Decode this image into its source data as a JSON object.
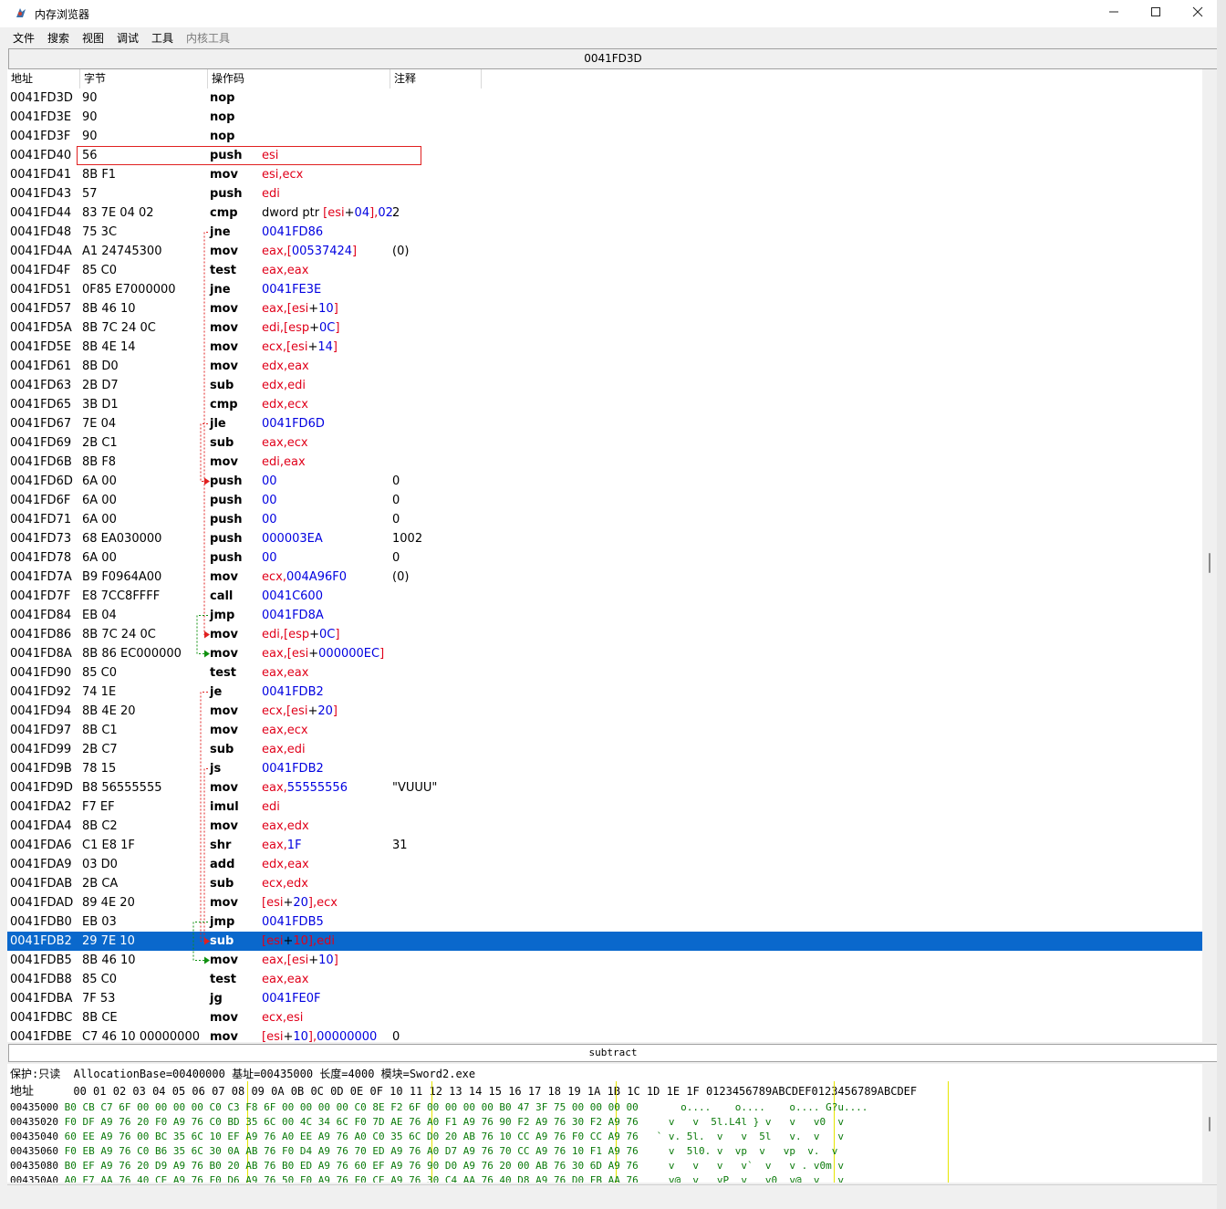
{
  "window": {
    "title": "内存浏览器",
    "address_bar": "0041FD3D",
    "minimize_icon": "minimize-icon",
    "maximize_icon": "maximize-icon",
    "close_icon": "close-icon"
  },
  "menu": [
    "文件",
    "搜索",
    "视图",
    "调试",
    "工具",
    "内核工具"
  ],
  "columns": {
    "addr": "地址",
    "bytes": "字节",
    "opcode": "操作码",
    "comment": "注释"
  },
  "disasm_rows": [
    {
      "addr": "0041FD3D",
      "bytes": "90",
      "op": "nop",
      "ops": [],
      "comment": ""
    },
    {
      "addr": "0041FD3E",
      "bytes": "90",
      "op": "nop",
      "ops": [],
      "comment": ""
    },
    {
      "addr": "0041FD3F",
      "bytes": "90",
      "op": "nop",
      "ops": [],
      "comment": ""
    },
    {
      "addr": "0041FD40",
      "bytes": "56",
      "op": "push",
      "ops": [
        [
          "t",
          "esi"
        ]
      ],
      "comment": ""
    },
    {
      "addr": "0041FD41",
      "bytes": "8B F1",
      "op": "mov",
      "ops": [
        [
          "t",
          "esi,ecx"
        ]
      ],
      "comment": ""
    },
    {
      "addr": "0041FD43",
      "bytes": "57",
      "op": "push",
      "ops": [
        [
          "t",
          "edi"
        ]
      ],
      "comment": ""
    },
    {
      "addr": "0041FD44",
      "bytes": "83 7E 04 02",
      "op": "cmp",
      "ops": [
        [
          "k",
          "dword ptr "
        ],
        [
          "t",
          "["
        ],
        [
          "t",
          "esi"
        ],
        [
          "k",
          "+"
        ],
        [
          "n",
          "04"
        ],
        [
          "t",
          "],"
        ],
        [
          "n",
          "02"
        ]
      ],
      "comment": "2"
    },
    {
      "addr": "0041FD48",
      "bytes": "75 3C",
      "op": "jne",
      "ops": [
        [
          "n",
          "0041FD86"
        ]
      ],
      "comment": ""
    },
    {
      "addr": "0041FD4A",
      "bytes": "A1 24745300",
      "op": "mov",
      "ops": [
        [
          "t",
          "eax,["
        ],
        [
          "n",
          "00537424"
        ],
        [
          "t",
          "]"
        ]
      ],
      "comment": "(0)"
    },
    {
      "addr": "0041FD4F",
      "bytes": "85 C0",
      "op": "test",
      "ops": [
        [
          "t",
          "eax,eax"
        ]
      ],
      "comment": ""
    },
    {
      "addr": "0041FD51",
      "bytes": "0F85 E7000000",
      "op": "jne",
      "ops": [
        [
          "n",
          "0041FE3E"
        ]
      ],
      "comment": ""
    },
    {
      "addr": "0041FD57",
      "bytes": "8B 46 10",
      "op": "mov",
      "ops": [
        [
          "t",
          "eax,[esi"
        ],
        [
          "k",
          "+"
        ],
        [
          "n",
          "10"
        ],
        [
          "t",
          "]"
        ]
      ],
      "comment": ""
    },
    {
      "addr": "0041FD5A",
      "bytes": "8B 7C 24 0C",
      "op": "mov",
      "ops": [
        [
          "t",
          "edi,[esp"
        ],
        [
          "k",
          "+"
        ],
        [
          "n",
          "0C"
        ],
        [
          "t",
          "]"
        ]
      ],
      "comment": ""
    },
    {
      "addr": "0041FD5E",
      "bytes": "8B 4E 14",
      "op": "mov",
      "ops": [
        [
          "t",
          "ecx,[esi"
        ],
        [
          "k",
          "+"
        ],
        [
          "n",
          "14"
        ],
        [
          "t",
          "]"
        ]
      ],
      "comment": ""
    },
    {
      "addr": "0041FD61",
      "bytes": "8B D0",
      "op": "mov",
      "ops": [
        [
          "t",
          "edx,eax"
        ]
      ],
      "comment": ""
    },
    {
      "addr": "0041FD63",
      "bytes": "2B D7",
      "op": "sub",
      "ops": [
        [
          "t",
          "edx,edi"
        ]
      ],
      "comment": ""
    },
    {
      "addr": "0041FD65",
      "bytes": "3B D1",
      "op": "cmp",
      "ops": [
        [
          "t",
          "edx,ecx"
        ]
      ],
      "comment": ""
    },
    {
      "addr": "0041FD67",
      "bytes": "7E 04",
      "op": "jle",
      "ops": [
        [
          "n",
          "0041FD6D"
        ]
      ],
      "comment": ""
    },
    {
      "addr": "0041FD69",
      "bytes": "2B C1",
      "op": "sub",
      "ops": [
        [
          "t",
          "eax,ecx"
        ]
      ],
      "comment": ""
    },
    {
      "addr": "0041FD6B",
      "bytes": "8B F8",
      "op": "mov",
      "ops": [
        [
          "t",
          "edi,eax"
        ]
      ],
      "comment": ""
    },
    {
      "addr": "0041FD6D",
      "bytes": "6A 00",
      "op": "push",
      "ops": [
        [
          "n",
          "00"
        ]
      ],
      "comment": "0"
    },
    {
      "addr": "0041FD6F",
      "bytes": "6A 00",
      "op": "push",
      "ops": [
        [
          "n",
          "00"
        ]
      ],
      "comment": "0"
    },
    {
      "addr": "0041FD71",
      "bytes": "6A 00",
      "op": "push",
      "ops": [
        [
          "n",
          "00"
        ]
      ],
      "comment": "0"
    },
    {
      "addr": "0041FD73",
      "bytes": "68 EA030000",
      "op": "push",
      "ops": [
        [
          "n",
          "000003EA"
        ]
      ],
      "comment": "1002"
    },
    {
      "addr": "0041FD78",
      "bytes": "6A 00",
      "op": "push",
      "ops": [
        [
          "n",
          "00"
        ]
      ],
      "comment": "0"
    },
    {
      "addr": "0041FD7A",
      "bytes": "B9 F0964A00",
      "op": "mov",
      "ops": [
        [
          "t",
          "ecx,"
        ],
        [
          "n",
          "004A96F0"
        ]
      ],
      "comment": "(0)"
    },
    {
      "addr": "0041FD7F",
      "bytes": "E8 7CC8FFFF",
      "op": "call",
      "ops": [
        [
          "n",
          "0041C600"
        ]
      ],
      "comment": ""
    },
    {
      "addr": "0041FD84",
      "bytes": "EB 04",
      "op": "jmp",
      "ops": [
        [
          "n",
          "0041FD8A"
        ]
      ],
      "comment": ""
    },
    {
      "addr": "0041FD86",
      "bytes": "8B 7C 24 0C",
      "op": "mov",
      "ops": [
        [
          "t",
          "edi,[esp"
        ],
        [
          "k",
          "+"
        ],
        [
          "n",
          "0C"
        ],
        [
          "t",
          "]"
        ]
      ],
      "comment": ""
    },
    {
      "addr": "0041FD8A",
      "bytes": "8B 86 EC000000",
      "op": "mov",
      "ops": [
        [
          "t",
          "eax,[esi"
        ],
        [
          "k",
          "+"
        ],
        [
          "n",
          "000000EC"
        ],
        [
          "t",
          "]"
        ]
      ],
      "comment": ""
    },
    {
      "addr": "0041FD90",
      "bytes": "85 C0",
      "op": "test",
      "ops": [
        [
          "t",
          "eax,eax"
        ]
      ],
      "comment": ""
    },
    {
      "addr": "0041FD92",
      "bytes": "74 1E",
      "op": "je",
      "ops": [
        [
          "n",
          "0041FDB2"
        ]
      ],
      "comment": ""
    },
    {
      "addr": "0041FD94",
      "bytes": "8B 4E 20",
      "op": "mov",
      "ops": [
        [
          "t",
          "ecx,[esi"
        ],
        [
          "k",
          "+"
        ],
        [
          "n",
          "20"
        ],
        [
          "t",
          "]"
        ]
      ],
      "comment": ""
    },
    {
      "addr": "0041FD97",
      "bytes": "8B C1",
      "op": "mov",
      "ops": [
        [
          "t",
          "eax,ecx"
        ]
      ],
      "comment": ""
    },
    {
      "addr": "0041FD99",
      "bytes": "2B C7",
      "op": "sub",
      "ops": [
        [
          "t",
          "eax,edi"
        ]
      ],
      "comment": ""
    },
    {
      "addr": "0041FD9B",
      "bytes": "78 15",
      "op": "js",
      "ops": [
        [
          "n",
          "0041FDB2"
        ]
      ],
      "comment": ""
    },
    {
      "addr": "0041FD9D",
      "bytes": "B8 56555555",
      "op": "mov",
      "ops": [
        [
          "t",
          "eax,"
        ],
        [
          "n",
          "55555556"
        ]
      ],
      "comment": "\"VUUU\""
    },
    {
      "addr": "0041FDA2",
      "bytes": "F7 EF",
      "op": "imul",
      "ops": [
        [
          "t",
          "edi"
        ]
      ],
      "comment": ""
    },
    {
      "addr": "0041FDA4",
      "bytes": "8B C2",
      "op": "mov",
      "ops": [
        [
          "t",
          "eax,edx"
        ]
      ],
      "comment": ""
    },
    {
      "addr": "0041FDA6",
      "bytes": "C1 E8 1F",
      "op": "shr",
      "ops": [
        [
          "t",
          "eax,"
        ],
        [
          "n",
          "1F"
        ]
      ],
      "comment": "31"
    },
    {
      "addr": "0041FDA9",
      "bytes": "03 D0",
      "op": "add",
      "ops": [
        [
          "t",
          "edx,eax"
        ]
      ],
      "comment": ""
    },
    {
      "addr": "0041FDAB",
      "bytes": "2B CA",
      "op": "sub",
      "ops": [
        [
          "t",
          "ecx,edx"
        ]
      ],
      "comment": ""
    },
    {
      "addr": "0041FDAD",
      "bytes": "89 4E 20",
      "op": "mov",
      "ops": [
        [
          "t",
          "[esi"
        ],
        [
          "k",
          "+"
        ],
        [
          "n",
          "20"
        ],
        [
          "t",
          "],ecx"
        ]
      ],
      "comment": ""
    },
    {
      "addr": "0041FDB0",
      "bytes": "EB 03",
      "op": "jmp",
      "ops": [
        [
          "n",
          "0041FDB5"
        ]
      ],
      "comment": ""
    },
    {
      "addr": "0041FDB2",
      "bytes": "29 7E 10",
      "op": "sub",
      "ops": [
        [
          "t",
          "[esi"
        ],
        [
          "k",
          "+"
        ],
        [
          "n",
          "10"
        ],
        [
          "t",
          "],edi"
        ]
      ],
      "comment": "",
      "selected": true
    },
    {
      "addr": "0041FDB5",
      "bytes": "8B 46 10",
      "op": "mov",
      "ops": [
        [
          "t",
          "eax,[esi"
        ],
        [
          "k",
          "+"
        ],
        [
          "n",
          "10"
        ],
        [
          "t",
          "]"
        ]
      ],
      "comment": ""
    },
    {
      "addr": "0041FDB8",
      "bytes": "85 C0",
      "op": "test",
      "ops": [
        [
          "t",
          "eax,eax"
        ]
      ],
      "comment": ""
    },
    {
      "addr": "0041FDBA",
      "bytes": "7F 53",
      "op": "jg",
      "ops": [
        [
          "n",
          "0041FE0F"
        ]
      ],
      "comment": ""
    },
    {
      "addr": "0041FDBC",
      "bytes": "8B CE",
      "op": "mov",
      "ops": [
        [
          "t",
          "ecx,esi"
        ]
      ],
      "comment": ""
    },
    {
      "addr": "0041FDBE",
      "bytes": "C7 46 10 00000000",
      "op": "mov",
      "ops": [
        [
          "t",
          "[esi"
        ],
        [
          "k",
          "+"
        ],
        [
          "n",
          "10"
        ],
        [
          "t",
          "],"
        ],
        [
          "n",
          "00000000"
        ]
      ],
      "comment": "0"
    }
  ],
  "status_text": "subtract",
  "hex": {
    "info": "保护:只读  AllocationBase=00400000 基址=00435000 长度=4000 模块=Sword2.exe",
    "header_label": "地址",
    "header_cols": "00 01 02 03 04 05 06 07 08 09 0A 0B 0C 0D 0E 0F 10 11 12 13 14 15 16 17 18 19 1A 1B 1C 1D 1E 1F 0123456789ABCDEF0123456789ABCDEF",
    "rows": [
      {
        "addr": "00435000",
        "bytes": "B0 CB C7 6F 00 00 00 00 C0 C3 F8 6F 00 00 00 00 C0 8E F2 6F 00 00 00 00 B0 47 3F 75 00 00 00 00",
        "ascii": "    o....    o....    o.... G?u...."
      },
      {
        "addr": "00435020",
        "bytes": "F0 DF A9 76 20 F0 A9 76 C0 BD 35 6C 00 4C 34 6C F0 7D AE 76 A0 F1 A9 76 90 F2 A9 76 30 F2 A9 76",
        "ascii": "  v   v  5l.L4l } v   v   v0  v"
      },
      {
        "addr": "00435040",
        "bytes": "60 EE A9 76 00 BC 35 6C 10 EF A9 76 A0 EE A9 76 A0 C0 35 6C D0 20 AB 76 10 CC A9 76 F0 CC A9 76",
        "ascii": "` v. 5l.  v   v  5l   v.  v   v"
      },
      {
        "addr": "00435060",
        "bytes": "F0 EB A9 76 C0 B6 35 6C 30 0A AB 76 F0 D4 A9 76 70 ED A9 76 A0 D7 A9 76 70 CC A9 76 10 F1 A9 76",
        "ascii": "  v  5l0. v  vp  v   vp  v.  v"
      },
      {
        "addr": "00435080",
        "bytes": "B0 EF A9 76 20 D9 A9 76 B0 20 AB 76 B0 ED A9 76 60 EF A9 76 90 D0 A9 76 20 00 AB 76 30 6D A9 76",
        "ascii": "  v   v   v   v`  v   v . v0m v"
      },
      {
        "addr": "004350A0",
        "bytes": "A0 E7 AA 76 40 CE A9 76 F0 D6 A9 76 50 F0 A9 76 F0 CE A9 76 30 C4 AA 76 40 D8 A9 76 D0 FB AA 76",
        "ascii": "  v@  v   vP  v   v0  v@  v   v"
      }
    ]
  },
  "colors": {
    "selection": "#0a68cc",
    "register": "#e0001a",
    "number": "#0000e0",
    "hex_bytes": "#0a7a0a",
    "jump_taken": "#e02020",
    "jump_fall": "#109010"
  }
}
